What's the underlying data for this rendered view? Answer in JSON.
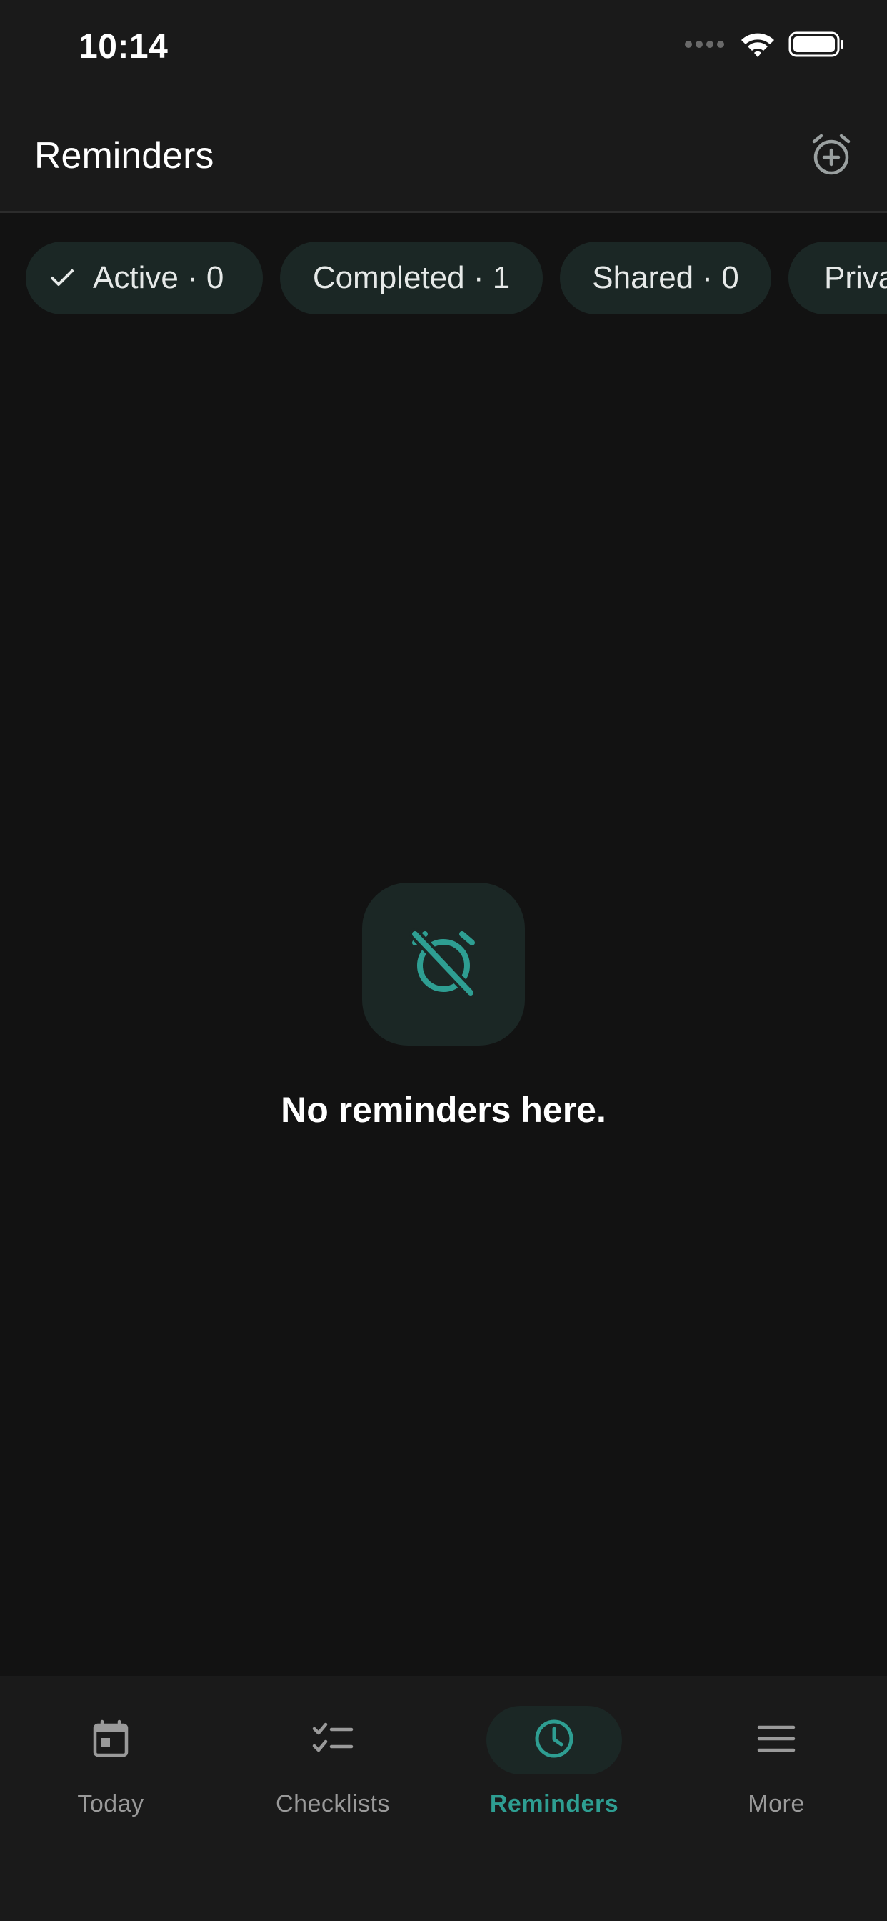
{
  "status_bar": {
    "time": "10:14"
  },
  "header": {
    "title": "Reminders",
    "add_icon": "alarm-add-icon"
  },
  "filters": [
    {
      "label": "Active · 0",
      "selected": true
    },
    {
      "label": "Completed · 1",
      "selected": false
    },
    {
      "label": "Shared · 0",
      "selected": false
    },
    {
      "label": "Priva",
      "selected": false
    }
  ],
  "empty_state": {
    "icon": "alarm-off-icon",
    "message": "No reminders here."
  },
  "bottom_nav": [
    {
      "label": "Today",
      "icon": "calendar-icon",
      "active": false
    },
    {
      "label": "Checklists",
      "icon": "checklist-icon",
      "active": false
    },
    {
      "label": "Reminders",
      "icon": "clock-icon",
      "active": true
    },
    {
      "label": "More",
      "icon": "menu-icon",
      "active": false
    }
  ],
  "colors": {
    "accent": "#2e9e92",
    "background": "#121212",
    "surface": "#1a1a1a",
    "chip_bg": "#1b2725"
  }
}
